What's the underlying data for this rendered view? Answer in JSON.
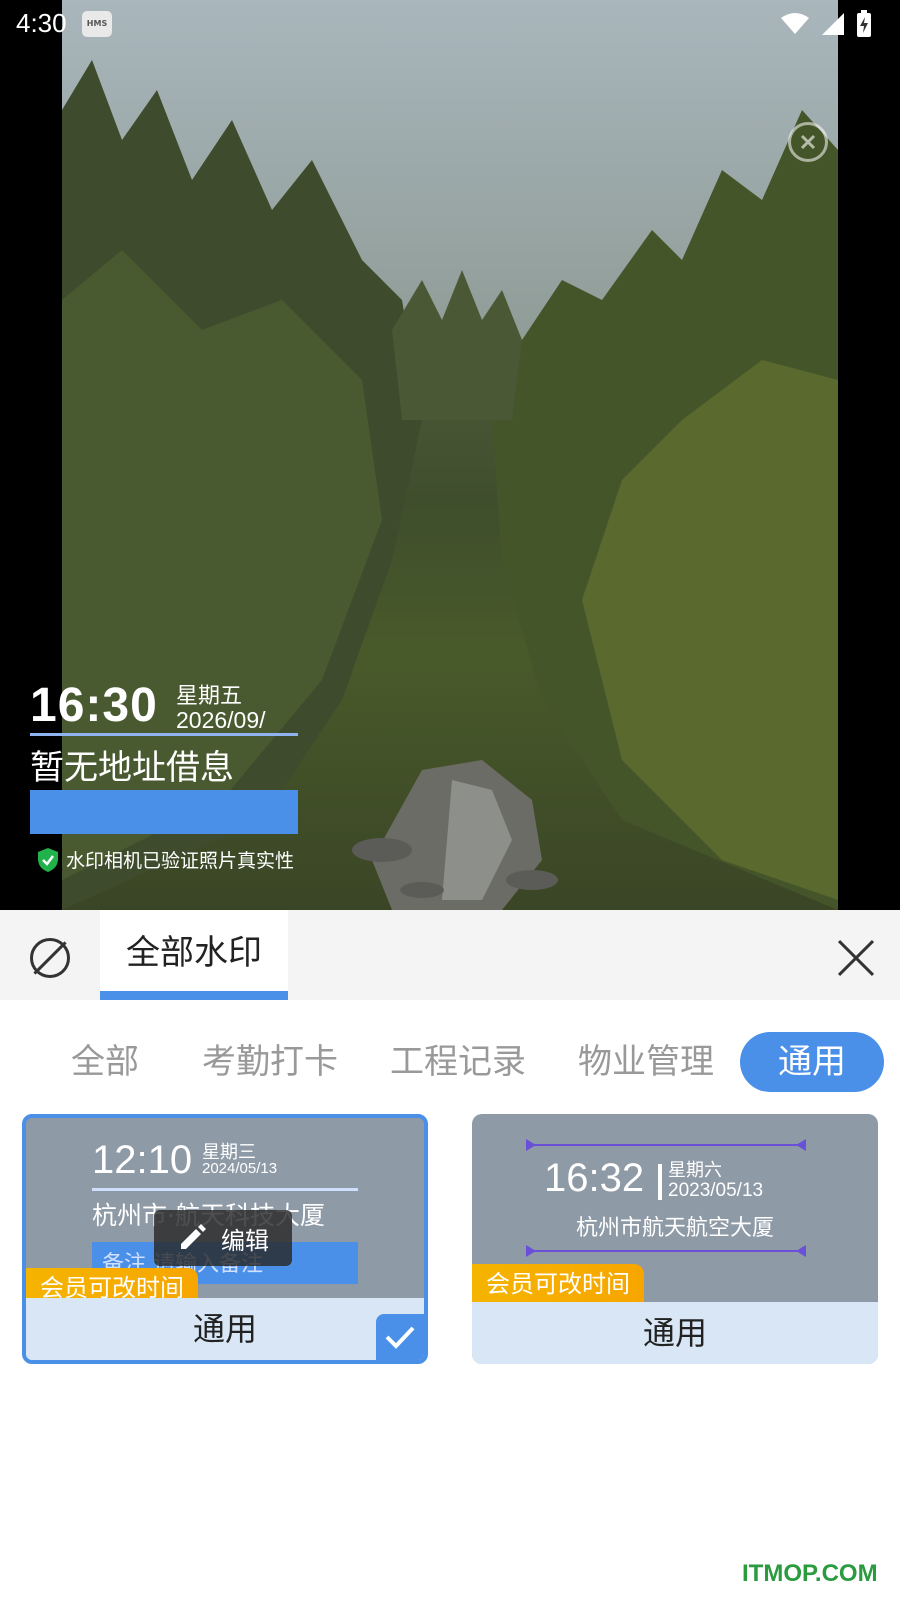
{
  "status_bar": {
    "time": "4:30",
    "badge": "HMS"
  },
  "watermark": {
    "time": "16:30",
    "weekday": "星期五",
    "date": "2026/09/",
    "address": "暂无地址借息",
    "verify_text": "水印相机已验证照片真实性"
  },
  "tabs": {
    "active_tab": "全部水印"
  },
  "categories": [
    {
      "label": "全部",
      "active": false
    },
    {
      "label": "考勤打卡",
      "active": false
    },
    {
      "label": "工程记录",
      "active": false
    },
    {
      "label": "物业管理",
      "active": false
    },
    {
      "label": "通用",
      "active": true
    }
  ],
  "templates": [
    {
      "time": "12:10",
      "weekday": "星期三",
      "date": "2024/05/13",
      "address": "杭州市·航天科技大厦",
      "note_text": "备注 请输入备注",
      "edit_label": "编辑",
      "vip_label": "会员可改时间",
      "category_label": "通用",
      "selected": true
    },
    {
      "time": "16:32",
      "weekday": "星期六",
      "date": "2023/05/13",
      "address": "杭州市航天航空大厦",
      "vip_label": "会员可改时间",
      "category_label": "通用",
      "selected": false
    }
  ],
  "site_logo": "ITMOP.COM",
  "colors": {
    "accent": "#4a8fe8",
    "vip": "#f5b400",
    "card_bg": "#8f9aa7",
    "card_footer": "#d8e6f5"
  }
}
